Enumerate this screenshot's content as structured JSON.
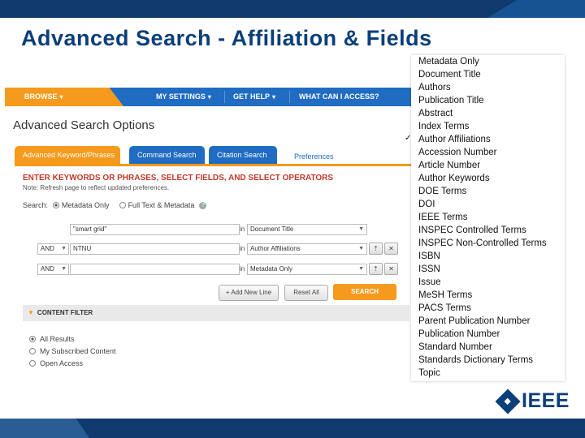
{
  "slide": {
    "title": "Advanced Search  - Affiliation & Fields",
    "logo_text": "IEEE"
  },
  "nav": {
    "browse": "BROWSE",
    "my_settings": "MY SETTINGS",
    "get_help": "GET HELP",
    "what_access": "WHAT CAN I ACCESS?"
  },
  "page": {
    "title": "Advanced Search Options",
    "tabs": [
      "Advanced Keyword/Phrases",
      "Command Search",
      "Citation Search",
      "Preferences"
    ],
    "instructions": "ENTER KEYWORDS OR PHRASES, SELECT FIELDS, AND SELECT OPERATORS",
    "note": "Note: Refresh page to reflect updated preferences.",
    "search_label": "Search:",
    "search_options": [
      "Metadata Only",
      "Full Text & Metadata"
    ]
  },
  "rows": [
    {
      "operator": "",
      "term": "\"smart grid\"",
      "in": "in",
      "field": "Document Title"
    },
    {
      "operator": "AND",
      "term": "NTNU",
      "in": "in",
      "field": "Author Affiliations"
    },
    {
      "operator": "AND",
      "term": "",
      "in": "in",
      "field": "Metadata Only"
    }
  ],
  "buttons": {
    "add_new_line": "+ Add New Line",
    "reset_all": "Reset All",
    "search": "SEARCH"
  },
  "content_filter": {
    "heading": "CONTENT FILTER",
    "options": [
      "All Results",
      "My Subscribed Content",
      "Open Access"
    ]
  },
  "dropdown": {
    "selected": "Author Affiliations",
    "check_mark": "✓",
    "items": [
      "Metadata Only",
      "Document Title",
      "Authors",
      "Publication Title",
      "Abstract",
      "Index Terms",
      "Author Affiliations",
      "Accession Number",
      "Article Number",
      "Author Keywords",
      "DOE Terms",
      "DOI",
      "IEEE Terms",
      "INSPEC Controlled Terms",
      "INSPEC Non-Controlled Terms",
      "ISBN",
      "ISSN",
      "Issue",
      "MeSH Terms",
      "PACS Terms",
      "Parent Publication Number",
      "Publication Number",
      "Standard Number",
      "Standards Dictionary Terms",
      "Topic"
    ]
  },
  "colors": {
    "brand_blue": "#1f6cc2",
    "accent_orange": "#f59a1c",
    "title_navy": "#0b3f7a"
  }
}
